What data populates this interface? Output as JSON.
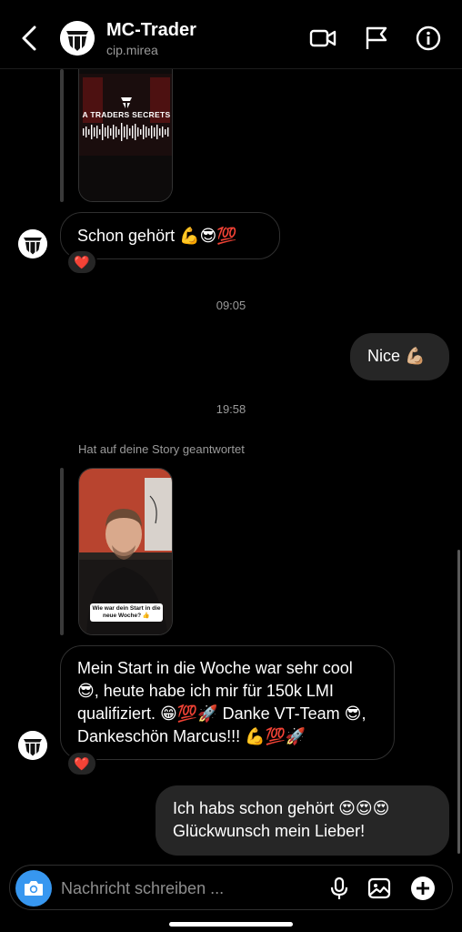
{
  "header": {
    "name": "MC-Trader",
    "username": "cip.mirea"
  },
  "story1": {
    "title": "A TRADERS SECRETS"
  },
  "messages": {
    "m1": {
      "text": "Schon gehört 💪😎💯",
      "reaction": "❤️"
    },
    "ts1": "09:05",
    "m2": {
      "text": "Nice 💪🏼"
    },
    "ts2": "19:58",
    "reply_note": "Hat auf deine Story geantwortet",
    "story2_caption": "Wie war dein Start in die neue Woche? 👍",
    "m3": {
      "text": "Mein Start in die Woche war sehr cool 😎, heute habe ich mir für 150k LMI qualifiziert. 😁💯🚀 Danke VT-Team 😎, Dankeschön Marcus!!! 💪💯🚀",
      "reaction": "❤️"
    },
    "m4": {
      "text": "Ich habs schon gehört 😍😍😍 Glückwunsch mein Lieber!"
    }
  },
  "composer": {
    "placeholder": "Nachricht schreiben ..."
  },
  "colors": {
    "accent": "#3797f0",
    "bubble_out": "#262626",
    "background": "#000000"
  }
}
